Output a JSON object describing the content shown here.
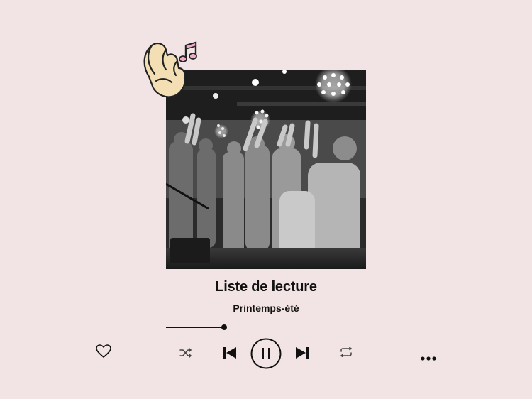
{
  "player": {
    "title": "Liste de lecture",
    "subtitle": "Printemps-été",
    "progress_fraction": 0.29
  },
  "artwork": {
    "description": "black-and-white concert photo",
    "sticker_icons": [
      "clapping-hand-icon",
      "music-note-icon"
    ]
  },
  "controls": {
    "like": "heart-icon",
    "shuffle": "shuffle-icon",
    "previous": "skip-previous-icon",
    "play_pause": "pause-icon",
    "next": "skip-next-icon",
    "repeat": "repeat-icon",
    "more": "more-dots-icon"
  },
  "colors": {
    "background": "#f2e4e4",
    "foreground": "#111111",
    "sticker_hand": "#f4dfb4",
    "sticker_note": "#f0a8c8"
  }
}
